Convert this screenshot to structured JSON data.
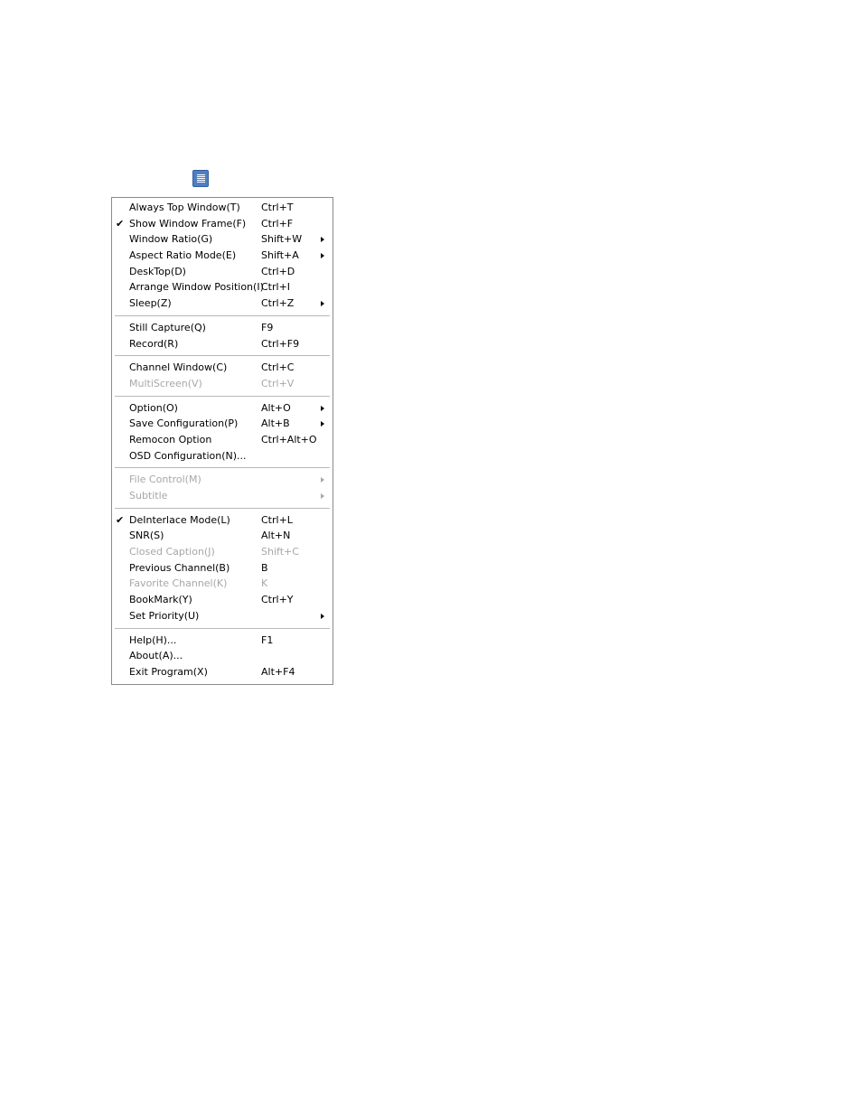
{
  "menu_button": {
    "icon": "menu-icon"
  },
  "menu": {
    "groups": [
      [
        {
          "check": "",
          "label": "Always Top Window(T)",
          "shortcut": "Ctrl+T",
          "submenu": false,
          "disabled": false
        },
        {
          "check": "✔",
          "label": "Show Window Frame(F)",
          "shortcut": "Ctrl+F",
          "submenu": false,
          "disabled": false
        },
        {
          "check": "",
          "label": "Window Ratio(G)",
          "shortcut": "Shift+W",
          "submenu": true,
          "disabled": false
        },
        {
          "check": "",
          "label": "Aspect Ratio Mode(E)",
          "shortcut": "Shift+A",
          "submenu": true,
          "disabled": false
        },
        {
          "check": "",
          "label": "DeskTop(D)",
          "shortcut": "Ctrl+D",
          "submenu": false,
          "disabled": false
        },
        {
          "check": "",
          "label": "Arrange Window Position(I)",
          "shortcut": "Ctrl+I",
          "submenu": false,
          "disabled": false
        },
        {
          "check": "",
          "label": "Sleep(Z)",
          "shortcut": "Ctrl+Z",
          "submenu": true,
          "disabled": false
        }
      ],
      [
        {
          "check": "",
          "label": "Still Capture(Q)",
          "shortcut": "F9",
          "submenu": false,
          "disabled": false
        },
        {
          "check": "",
          "label": "Record(R)",
          "shortcut": "Ctrl+F9",
          "submenu": false,
          "disabled": false
        }
      ],
      [
        {
          "check": "",
          "label": "Channel Window(C)",
          "shortcut": "Ctrl+C",
          "submenu": false,
          "disabled": false
        },
        {
          "check": "",
          "label": "MultiScreen(V)",
          "shortcut": "Ctrl+V",
          "submenu": false,
          "disabled": true
        }
      ],
      [
        {
          "check": "",
          "label": "Option(O)",
          "shortcut": "Alt+O",
          "submenu": true,
          "disabled": false
        },
        {
          "check": "",
          "label": "Save Configuration(P)",
          "shortcut": "Alt+B",
          "submenu": true,
          "disabled": false
        },
        {
          "check": "",
          "label": "Remocon Option",
          "shortcut": "Ctrl+Alt+O",
          "submenu": false,
          "disabled": false
        },
        {
          "check": "",
          "label": "OSD Configuration(N)...",
          "shortcut": "",
          "submenu": false,
          "disabled": false
        }
      ],
      [
        {
          "check": "",
          "label": "File Control(M)",
          "shortcut": "",
          "submenu": true,
          "disabled": true
        },
        {
          "check": "",
          "label": "Subtitle",
          "shortcut": "",
          "submenu": true,
          "disabled": true
        }
      ],
      [
        {
          "check": "✔",
          "label": "DeInterlace Mode(L)",
          "shortcut": "Ctrl+L",
          "submenu": false,
          "disabled": false
        },
        {
          "check": "",
          "label": "SNR(S)",
          "shortcut": "Alt+N",
          "submenu": false,
          "disabled": false
        },
        {
          "check": "",
          "label": "Closed Caption(J)",
          "shortcut": "Shift+C",
          "submenu": false,
          "disabled": true
        },
        {
          "check": "",
          "label": "Previous Channel(B)",
          "shortcut": "B",
          "submenu": false,
          "disabled": false
        },
        {
          "check": "",
          "label": "Favorite Channel(K)",
          "shortcut": "K",
          "submenu": false,
          "disabled": true
        },
        {
          "check": "",
          "label": "BookMark(Y)",
          "shortcut": "Ctrl+Y",
          "submenu": false,
          "disabled": false
        },
        {
          "check": "",
          "label": "Set Priority(U)",
          "shortcut": "",
          "submenu": true,
          "disabled": false
        }
      ],
      [
        {
          "check": "",
          "label": "Help(H)...",
          "shortcut": "F1",
          "submenu": false,
          "disabled": false
        },
        {
          "check": "",
          "label": "About(A)...",
          "shortcut": "",
          "submenu": false,
          "disabled": false
        },
        {
          "check": "",
          "label": "Exit Program(X)",
          "shortcut": "Alt+F4",
          "submenu": false,
          "disabled": false
        }
      ]
    ]
  }
}
